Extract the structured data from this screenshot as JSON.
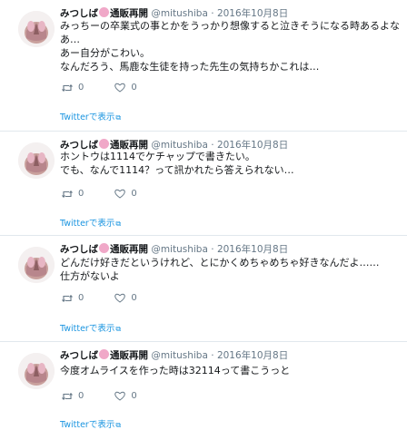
{
  "tweets": [
    {
      "name": "みつしば",
      "badge_text": "通販再開",
      "handle": "@mitushiba",
      "separator": "·",
      "date": "2016年10月8日",
      "lines": [
        "みっちーの卒業式の事とかをうっかり想像すると泣きそうになる時あるよな",
        "あ…",
        "あー自分がこわい。",
        "なんだろう、馬鹿な生徒を持った先生の気持ちかこれは…"
      ],
      "retweets": "0",
      "likes": "0",
      "view_link": "Twitterで表示"
    },
    {
      "name": "みつしば",
      "badge_text": "通販再開",
      "handle": "@mitushiba",
      "separator": "·",
      "date": "2016年10月8日",
      "lines": [
        "ホントウは1114でケチャップで書きたい。",
        "でも、なんで1114？って訊かれたら答えられない…"
      ],
      "retweets": "0",
      "likes": "0",
      "view_link": "Twitterで表示"
    },
    {
      "name": "みつしば",
      "badge_text": "通販再開",
      "handle": "@mitushiba",
      "separator": "·",
      "date": "2016年10月8日",
      "lines": [
        "どんだけ好きだというけれど、とにかくめちゃめちゃ好きなんだよ……",
        "仕方がないよ"
      ],
      "retweets": "0",
      "likes": "0",
      "view_link": "Twitterで表示"
    },
    {
      "name": "みつしば",
      "badge_text": "通販再開",
      "handle": "@mitushiba",
      "separator": "·",
      "date": "2016年10月8日",
      "lines": [
        "今度オムライスを作った時は32114って書こうっと"
      ],
      "retweets": "0",
      "likes": "0",
      "view_link": "Twitterで表示"
    }
  ],
  "colors": {
    "link": "#1b95e0",
    "muted": "#657786",
    "divider": "#e1e8ed",
    "badge": "#f0a8c8"
  },
  "icons": {
    "avatar": "avatar-image",
    "retweet": "retweet-icon",
    "like": "heart-icon",
    "external": "external-link-icon"
  }
}
